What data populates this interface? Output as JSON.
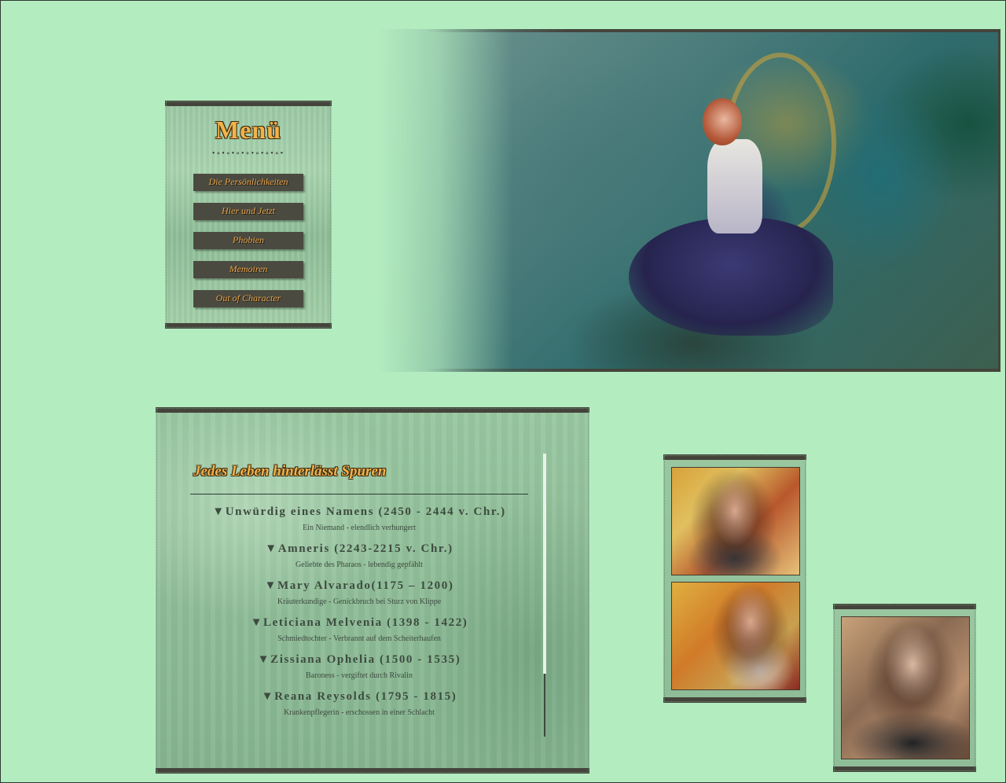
{
  "menu": {
    "title": "Menü",
    "dots": "•∘•∘•∘•∘•∘•∘•∘•",
    "items": [
      {
        "label": "Die Persönlichkeiten"
      },
      {
        "label": "Hier und Jetzt"
      },
      {
        "label": "Phobien"
      },
      {
        "label": "Memoiren"
      },
      {
        "label": "Out of Character"
      }
    ]
  },
  "story": {
    "heading": "Jedes Leben hinterlässt Spuren",
    "entries": [
      {
        "name": "▼Unwürdig eines Namens (2450 - 2444 v. Chr.)",
        "desc": "Ein Niemand - elendlich verhungert"
      },
      {
        "name": "▼Amneris (2243-2215 v. Chr.)",
        "desc": "Geliebte des Pharaos - lebendig gepfählt"
      },
      {
        "name": "▼Mary Alvarado(1175 – 1200)",
        "desc": "Kräuterkundige - Genickbruch bei Sturz von Klippe"
      },
      {
        "name": "▼Leticiana Melvenia (1398 - 1422)",
        "desc": "Schmiedtochter - Verbrannt auf dem Scheiterhaufen"
      },
      {
        "name": "▼Zissiana Ophelia (1500 - 1535)",
        "desc": "Baroness - vergiftet durch Rivalin"
      },
      {
        "name": "▼Reana Reysolds (1795 - 1815)",
        "desc": "Krankenpflegerin - erschossen in einer Schlacht"
      }
    ]
  },
  "colors": {
    "background": "#b3ecbf",
    "frame": "#44443b",
    "accent": "#f2b24a",
    "text": "#3d4a3f"
  }
}
